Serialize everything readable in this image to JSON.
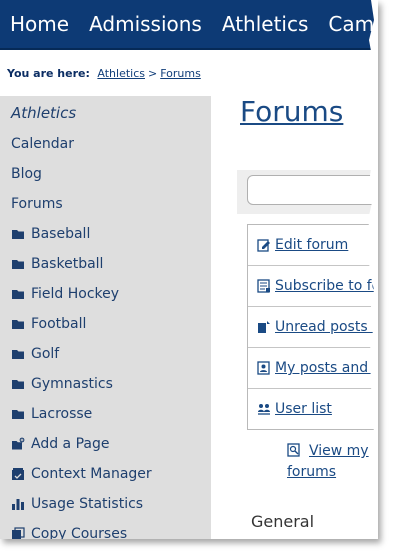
{
  "nav": {
    "items": [
      "Home",
      "Admissions",
      "Athletics",
      "Campu"
    ]
  },
  "breadcrumb": {
    "label": "You are here:",
    "links": [
      "Athletics",
      "Forums"
    ],
    "separator": ">"
  },
  "sidebar": {
    "heading": "Athletics",
    "items": [
      {
        "label": "Calendar",
        "icon": ""
      },
      {
        "label": "Blog",
        "icon": ""
      },
      {
        "label": "Forums",
        "icon": ""
      },
      {
        "label": "Baseball",
        "icon": "folder-icon"
      },
      {
        "label": "Basketball",
        "icon": "folder-icon"
      },
      {
        "label": "Field Hockey",
        "icon": "folder-icon"
      },
      {
        "label": "Football",
        "icon": "folder-icon"
      },
      {
        "label": "Golf",
        "icon": "folder-icon"
      },
      {
        "label": "Gymnastics",
        "icon": "folder-icon"
      },
      {
        "label": "Lacrosse",
        "icon": "folder-icon"
      },
      {
        "label": "Add a Page",
        "icon": "add-page-icon"
      },
      {
        "label": "Context Manager",
        "icon": "context-manager-icon"
      },
      {
        "label": "Usage Statistics",
        "icon": "bar-chart-icon"
      },
      {
        "label": "Copy Courses",
        "icon": "copy-icon"
      }
    ]
  },
  "main": {
    "title": "Forums",
    "search": {
      "value": "",
      "placeholder": ""
    },
    "actions": [
      {
        "label": "Edit forum",
        "icon": "edit-icon"
      },
      {
        "label": "Subscribe to fo",
        "icon": "subscribe-icon"
      },
      {
        "label": "Unread posts a",
        "icon": "unread-icon"
      },
      {
        "label": "My posts and r",
        "icon": "my-posts-icon"
      },
      {
        "label": "User list",
        "icon": "user-list-icon"
      }
    ],
    "view_my": "View my forums",
    "section": "General"
  },
  "colors": {
    "nav_bg": "#0d3a75",
    "sidebar_bg": "#dedede",
    "link": "#1a4a84",
    "icon": "#1e3f6e"
  }
}
